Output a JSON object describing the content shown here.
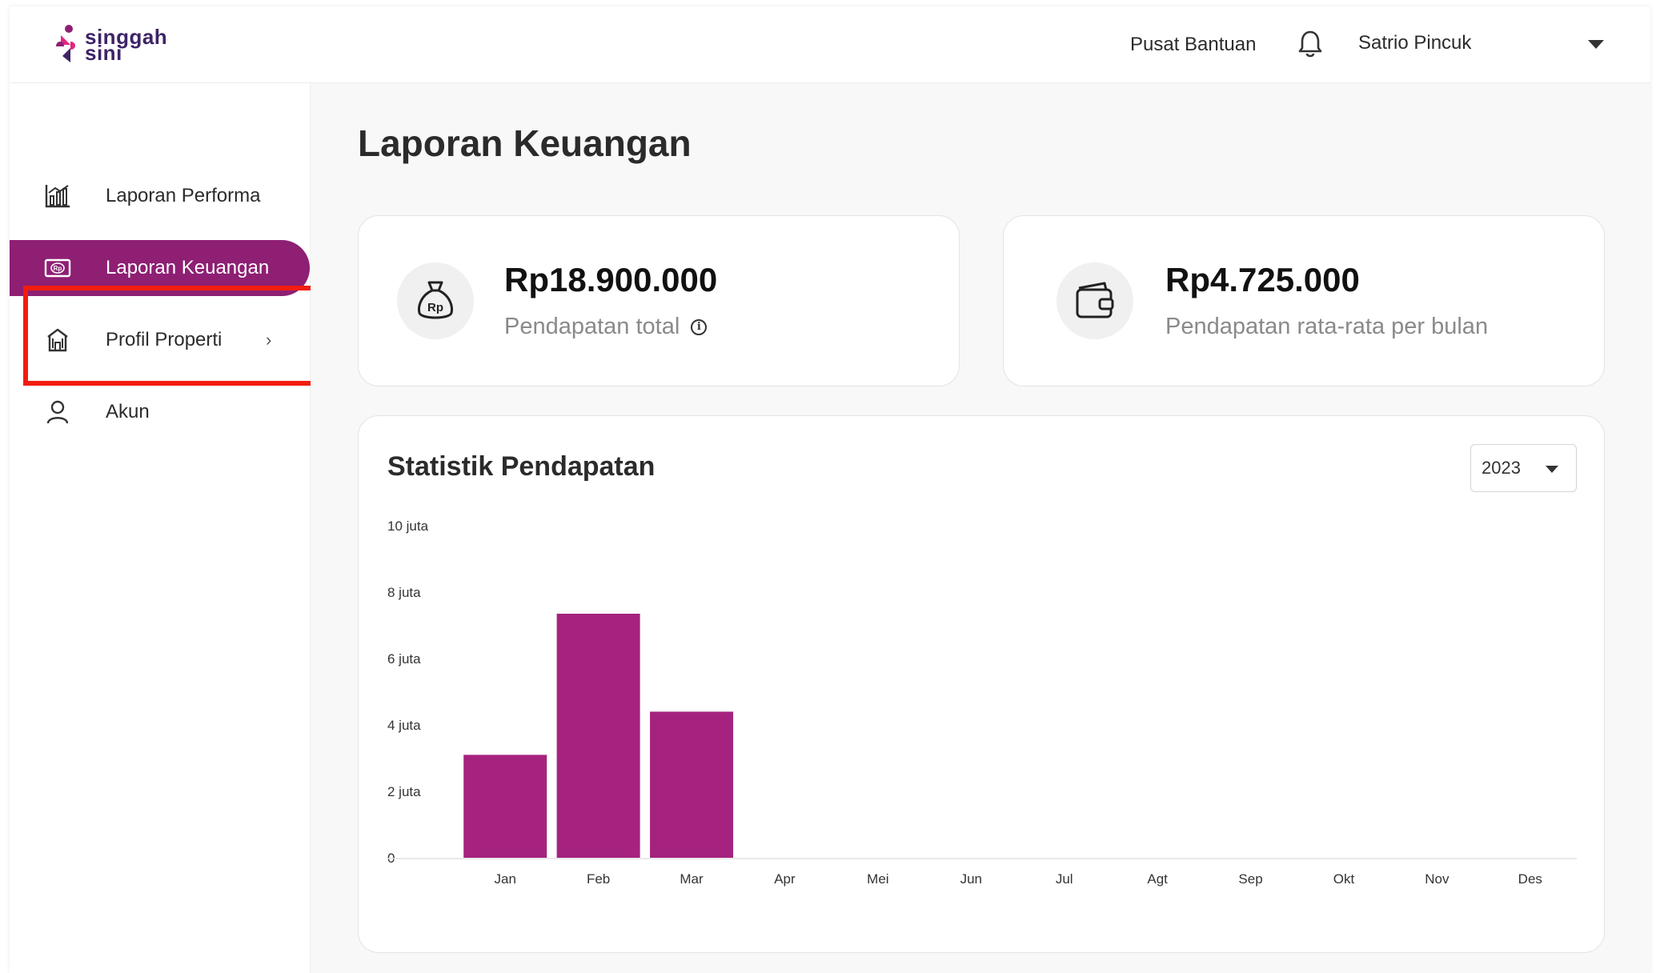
{
  "header": {
    "logo_line1": "singgah",
    "logo_line2": "sini",
    "help_label": "Pusat Bantuan",
    "user_name": "Satrio Pincuk"
  },
  "sidebar": {
    "items": [
      {
        "label": "Laporan Performa",
        "icon": "chart-icon"
      },
      {
        "label": "Laporan Keuangan",
        "icon": "money-icon",
        "active": true
      },
      {
        "label": "Profil Properti",
        "icon": "building-icon"
      },
      {
        "label": "Akun",
        "icon": "user-icon"
      }
    ]
  },
  "main": {
    "title": "Laporan Keuangan",
    "cards": [
      {
        "value": "Rp18.900.000",
        "label": "Pendapatan total",
        "icon": "money-bag-icon"
      },
      {
        "value": "Rp4.725.000",
        "label": "Pendapatan rata-rata per bulan",
        "icon": "wallet-icon"
      }
    ],
    "chart_title": "Statistik Pendapatan",
    "year": "2023"
  },
  "colors": {
    "brand": "#8e1f73",
    "bar": "#a5237e",
    "highlight": "#f21d0f"
  },
  "chart_data": {
    "type": "bar",
    "title": "Statistik Pendapatan",
    "categories": [
      "Jan",
      "Feb",
      "Mar",
      "Apr",
      "Mei",
      "Jun",
      "Jul",
      "Agt",
      "Sep",
      "Okt",
      "Nov",
      "Des"
    ],
    "values": [
      3100000,
      7350000,
      4400000,
      0,
      0,
      0,
      0,
      0,
      0,
      0,
      0,
      0
    ],
    "ylim": [
      0,
      10000000
    ],
    "yticks": [
      0,
      2000000,
      4000000,
      6000000,
      8000000,
      10000000
    ],
    "ytick_labels": [
      "0",
      "2 juta",
      "4 juta",
      "6 juta",
      "8 juta",
      "10 juta"
    ],
    "xlabel": "",
    "ylabel": "",
    "grid": false
  }
}
